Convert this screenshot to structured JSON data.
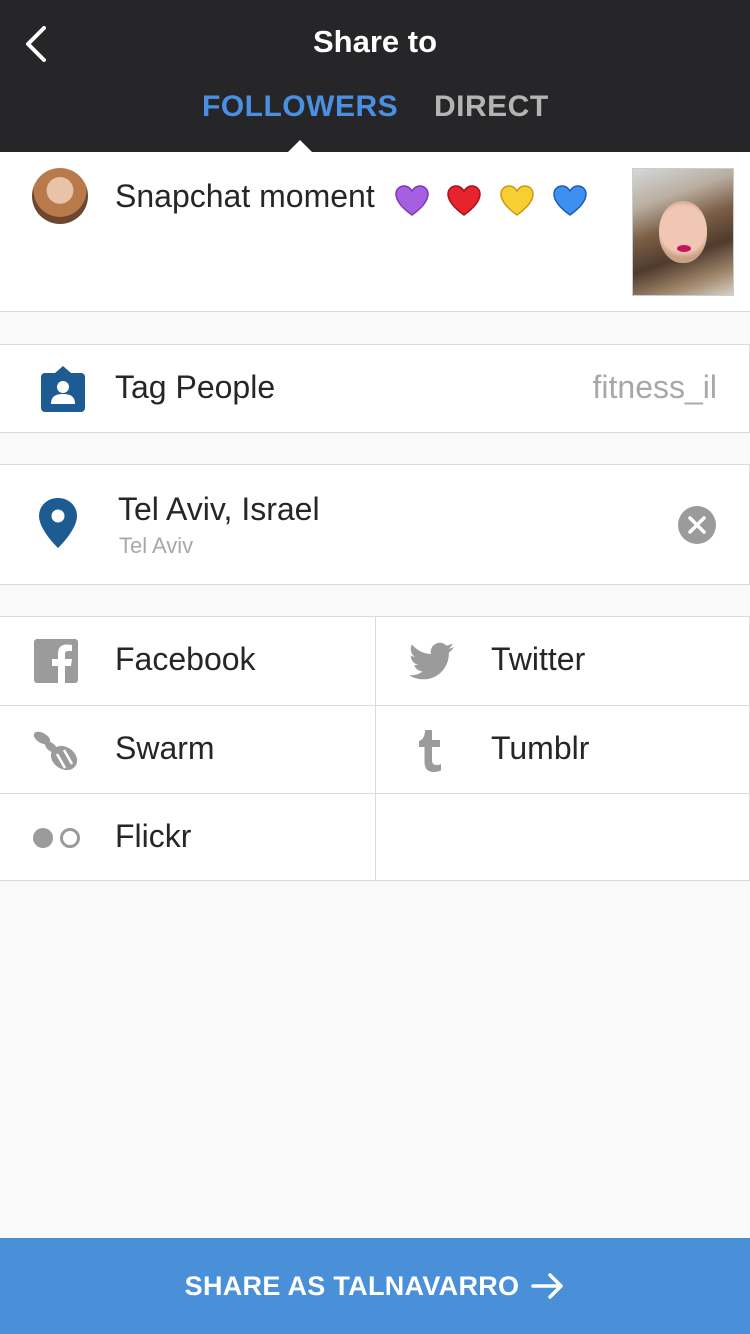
{
  "header": {
    "title": "Share to",
    "tabs": [
      {
        "label": "FOLLOWERS",
        "active": true
      },
      {
        "label": "DIRECT",
        "active": false
      }
    ],
    "accent_color": "#4a90e2"
  },
  "post": {
    "caption": "Snapchat moment",
    "emojis": [
      "purple-heart",
      "red-heart",
      "yellow-heart",
      "blue-heart"
    ]
  },
  "tag_people": {
    "label": "Tag People",
    "value": "fitness_il"
  },
  "location": {
    "name": "Tel Aviv, Israel",
    "subtitle": "Tel Aviv"
  },
  "share_targets": [
    {
      "label": "Facebook",
      "icon": "facebook-icon"
    },
    {
      "label": "Twitter",
      "icon": "twitter-icon"
    },
    {
      "label": "Swarm",
      "icon": "swarm-icon"
    },
    {
      "label": "Tumblr",
      "icon": "tumblr-icon"
    },
    {
      "label": "Flickr",
      "icon": "flickr-icon"
    }
  ],
  "share_button": {
    "label": "SHARE AS TALNAVARRO",
    "color": "#4a90d9"
  }
}
